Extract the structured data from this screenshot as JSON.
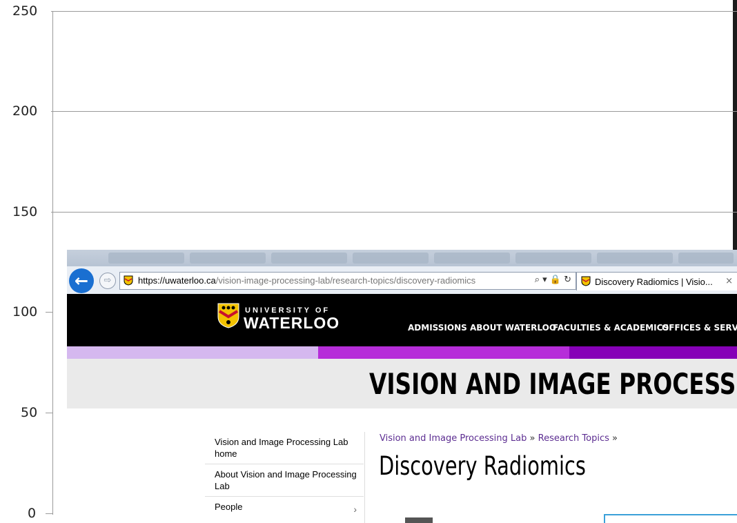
{
  "chart": {
    "y_ticks": [
      "250",
      "200",
      "150",
      "100",
      "50",
      "0"
    ]
  },
  "browser": {
    "url_domain": "https://uwaterloo.ca",
    "url_path": "/vision-image-processing-lab/research-topics/discovery-radiomics",
    "url_icons": "⌕ ▾ 🔒 ↻",
    "tab_title": "Discovery Radiomics | Visio...",
    "tab_close": "×",
    "back_icon": "arrow-left-icon",
    "forward_icon": "arrow-right-icon"
  },
  "site": {
    "logo_top": "UNIVERSITY OF",
    "logo_main": "WATERLOO",
    "nav": [
      "ADMISSIONS",
      "ABOUT WATERLOO",
      "FACULTIES & ACADEMICS",
      "OFFICES & SERVICES"
    ],
    "stripe_colors": [
      "#d5b8ef",
      "#b62dd9",
      "#8600b7"
    ],
    "banner_title": "VISION AND IMAGE PROCESSING L"
  },
  "sidebar": {
    "items": [
      {
        "label": "Vision and Image Processing Lab home"
      },
      {
        "label": "About Vision and Image Processing Lab"
      },
      {
        "label": "People"
      }
    ],
    "people_arrow": "›"
  },
  "content": {
    "crumb_1": "Vision and Image Processing Lab",
    "crumb_sep": "»",
    "crumb_2": "Research Topics",
    "page_title": "Discovery Radiomics"
  }
}
